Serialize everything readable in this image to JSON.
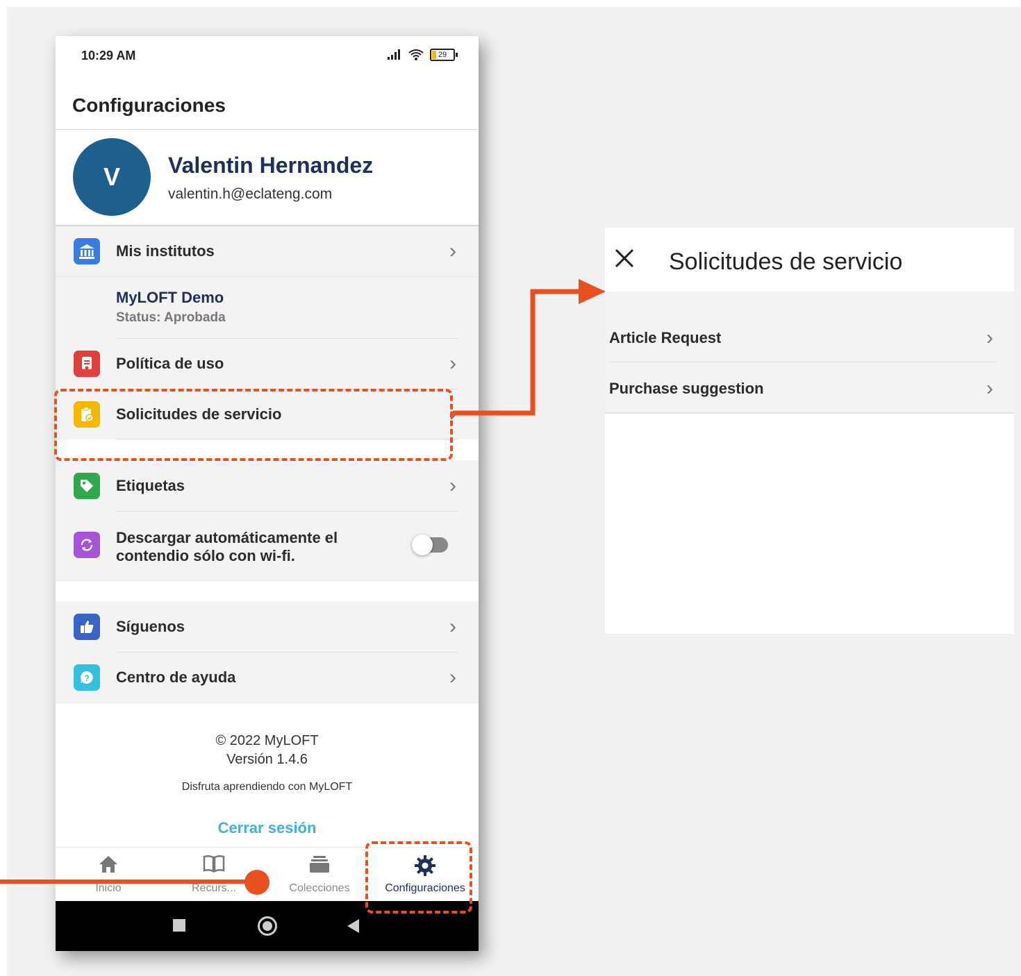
{
  "status_bar": {
    "time": "10:29 AM",
    "battery": "29"
  },
  "header": {
    "title": "Configuraciones"
  },
  "profile": {
    "initial": "V",
    "name": "Valentin Hernandez",
    "email": "valentin.h@eclateng.com"
  },
  "menu": {
    "institutes": "Mis institutos",
    "institute_name": "MyLOFT Demo",
    "institute_status": "Status: Aprobada",
    "usage_policy": "Política de uso",
    "service_requests": "Solicitudes de servicio",
    "labels": "Etiquetas",
    "auto_download_line1": "Descargar automáticamente el",
    "auto_download_line2": "contendio sólo con wi-fi.",
    "follow_us": "Síguenos",
    "help_center": "Centro de ayuda"
  },
  "footer": {
    "copyright": "© 2022 MyLOFT",
    "version": "Versión 1.4.6",
    "tagline": "Disfruta aprendiendo con MyLOFT",
    "logout": "Cerrar sesión"
  },
  "bottom_nav": {
    "home": "Inicio",
    "resources": "Recurs...",
    "collections": "Colecciones",
    "settings": "Configuraciones"
  },
  "panel": {
    "title": "Solicitudes de servicio",
    "items": [
      "Article Request",
      "Purchase suggestion"
    ]
  },
  "colors": {
    "accent": "#e8501f",
    "brand_navy": "#1f2f5c",
    "avatar_blue": "#1f5f8e",
    "logout_cyan": "#3fb0d6"
  },
  "toggle": {
    "auto_download_on": false
  }
}
